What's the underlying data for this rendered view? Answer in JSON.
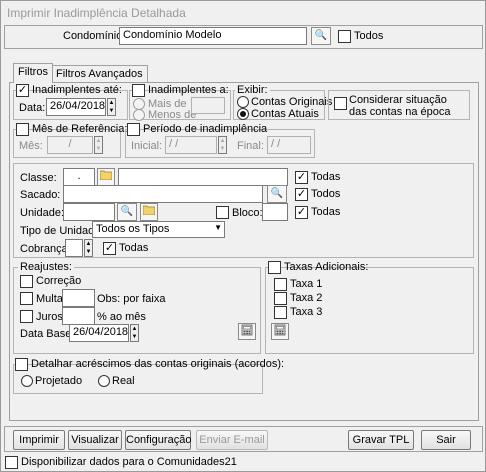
{
  "window": {
    "title": "Imprimir Inadimplência Detalhada"
  },
  "condominio": {
    "label": "Condomínio:",
    "value": "Condomínio Modelo",
    "todos_label": "Todos",
    "todos_checked": false
  },
  "tabs": [
    {
      "label": "Filtros",
      "active": true
    },
    {
      "label": "Filtros Avançados",
      "active": false
    }
  ],
  "inadimplentes_ate": {
    "label": "Inadimplentes até:",
    "checked": true,
    "data_label": "Data:",
    "data_value": "26/04/2018"
  },
  "inadimplentes_a": {
    "label": "Inadimplentes a:",
    "checked": false,
    "mais_de": "Mais de",
    "menos_de": "Menos de"
  },
  "exibir": {
    "legend": "Exibir:",
    "contas_originais": "Contas Originais",
    "contas_atuais": "Contas Atuais",
    "selected": "contas_atuais"
  },
  "considerar": {
    "label_line1": "Considerar situação",
    "label_line2": "das contas na época",
    "checked": false
  },
  "mes_referencia": {
    "label": "Mês de Referência:",
    "checked": false,
    "mes_label": "Mês:",
    "mes_value": "/"
  },
  "periodo": {
    "label": "Período de inadimplência",
    "checked": false,
    "inicial_label": "Inicial:",
    "inicial_value": "/ /",
    "final_label": "Final:",
    "final_value": "/ /"
  },
  "filtros": {
    "classe_label": "Classe:",
    "classe_code": ".",
    "classe_desc": "",
    "classe_todas": "Todas",
    "classe_todas_checked": true,
    "sacado_label": "Sacado:",
    "sacado_value": "",
    "sacado_todos": "Todos",
    "sacado_todos_checked": true,
    "unidade_label": "Unidade:",
    "unidade_value": "",
    "bloco_label": "Bloco:",
    "bloco_checked": false,
    "bloco_value": "",
    "unidade_todas": "Todas",
    "unidade_todas_checked": true,
    "tipo_unidade_label": "Tipo de Unidade:",
    "tipo_unidade_value": "Todos os Tipos",
    "cobranca_label": "Cobrança:",
    "cobranca_value": "",
    "cobranca_todas": "Todas",
    "cobranca_todas_checked": true
  },
  "reajustes": {
    "legend": "Reajustes:",
    "correcao": "Correção",
    "correcao_checked": false,
    "multa": "Multa",
    "multa_checked": false,
    "multa_value": "",
    "multa_suffix": "Obs: por faixa",
    "juros": "Juros",
    "juros_checked": false,
    "juros_value": "",
    "juros_suffix": "% ao mês",
    "data_base_label": "Data Base:",
    "data_base_value": "26/04/2018"
  },
  "taxas": {
    "label": "Taxas Adicionais:",
    "checked": false,
    "items": [
      "Taxa 1",
      "Taxa 2",
      "Taxa 3"
    ]
  },
  "acordos": {
    "label": "Detalhar acréscimos das contas originais (acordos):",
    "checked": false,
    "projetado": "Projetado",
    "real": "Real"
  },
  "buttons": {
    "imprimir": "Imprimir",
    "visualizar": "Visualizar",
    "configuracao": "Configuração",
    "enviar_email": "Enviar E-mail",
    "gravar_tpl": "Gravar TPL",
    "sair": "Sair"
  },
  "comunidades": {
    "label": "Disponibilizar dados para o Comunidades21",
    "checked": false
  },
  "icons": {
    "binoculars": "binoculars-icon",
    "folder": "folder-icon",
    "calculator": "calculator-icon",
    "dropdown": "chevron-down-icon"
  },
  "colors": {
    "folder": "#f2d36b",
    "window_bg": "#f0f0f0",
    "disabled_text": "#8a8a8a"
  }
}
